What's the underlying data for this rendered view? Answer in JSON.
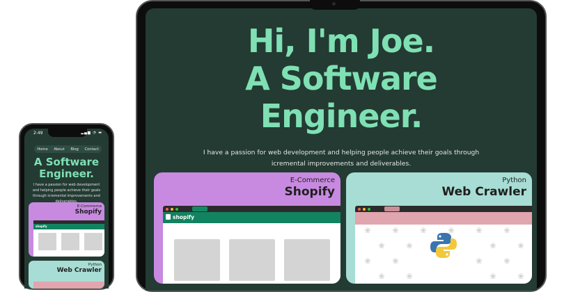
{
  "laptop": {
    "hero_line1": "Hi, I'm Joe.",
    "hero_line2": "A Software",
    "hero_line3": "Engineer.",
    "tagline": "I have a passion for web development and helping people achieve their goals through icremental improvements and deliverables.",
    "cards": [
      {
        "subtitle": "E-Commerce",
        "title": "Shopify",
        "store_name": "shopify"
      },
      {
        "subtitle": "Python",
        "title": "Web Crawler"
      }
    ]
  },
  "phone": {
    "time": "2:49",
    "status_icons": "▂▄▆ ◔ ▬",
    "nav": [
      "Home",
      "About",
      "Blog",
      "Contact"
    ],
    "hero_line1": "A Software",
    "hero_line2": "Engineer.",
    "tagline": "I have a passion for web development and helping people achieve their goals through icremental improvements and deliverables.",
    "cards": [
      {
        "subtitle": "E-Commerce",
        "title": "Shopify",
        "store_name": "shopify"
      },
      {
        "subtitle": "Python",
        "title": "Web Crawler"
      }
    ]
  },
  "colors": {
    "background": "#233b33",
    "accent": "#7fe0b4",
    "shopify_card": "#c88ae0",
    "crawler_card": "#a7ddd4",
    "shopify_green": "#128360",
    "crawler_header": "#e0a5ae"
  },
  "icons": [
    "shopify-bag-icon",
    "python-logo-icon",
    "bug-icon"
  ]
}
